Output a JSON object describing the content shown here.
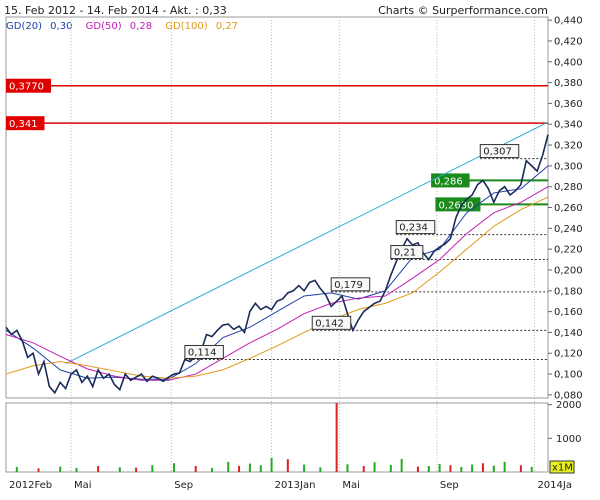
{
  "header": {
    "range_text": "15. Feb 2012 - 14. Feb 2014 - Akt. : 0,33",
    "credit_text": "Charts © Surperformance.com"
  },
  "legend": [
    {
      "label": "GD(20)",
      "value": "0,30",
      "color": "#1f3fa8"
    },
    {
      "label": "GD(50)",
      "value": "0,28",
      "color": "#c21fb8"
    },
    {
      "label": "GD(100)",
      "value": "0,27",
      "color": "#e09a1a"
    }
  ],
  "colors": {
    "price": "#1a2a5a",
    "trendline": "#29a9d9",
    "resistance": "#e00000",
    "support": "#1a8a1a",
    "level": "#333333",
    "volume_up": "#22aa22",
    "volume_down": "#dd2222",
    "label_bg": "#f8f8f8"
  },
  "chart_data": {
    "type": "line",
    "x_labels": [
      {
        "t": 0.0,
        "label": "2012Feb"
      },
      {
        "t": 0.12,
        "label": "Mai"
      },
      {
        "t": 0.305,
        "label": "Sep"
      },
      {
        "t": 0.49,
        "label": "2013Jan"
      },
      {
        "t": 0.615,
        "label": "Mai"
      },
      {
        "t": 0.795,
        "label": "Sep"
      },
      {
        "t": 0.975,
        "label": "2014Ja"
      }
    ],
    "y_ticks": [
      0.08,
      0.1,
      0.12,
      0.14,
      0.16,
      0.18,
      0.2,
      0.22,
      0.24,
      0.26,
      0.28,
      0.3,
      0.32,
      0.34,
      0.36,
      0.38,
      0.4,
      0.42,
      0.44
    ],
    "y_tick_labels": [
      "0,080",
      "0,100",
      "0,120",
      "0,140",
      "0,160",
      "0,180",
      "0,200",
      "0,220",
      "0,240",
      "0,260",
      "0,280",
      "0,300",
      "0,320",
      "0,340",
      "0,360",
      "0,380",
      "0,400",
      "0,420",
      "0,440"
    ],
    "ylim": [
      0.077,
      0.443
    ],
    "price": {
      "x": [
        0.0,
        0.01,
        0.02,
        0.03,
        0.04,
        0.05,
        0.06,
        0.07,
        0.08,
        0.09,
        0.1,
        0.11,
        0.12,
        0.13,
        0.14,
        0.15,
        0.16,
        0.17,
        0.18,
        0.19,
        0.2,
        0.21,
        0.22,
        0.23,
        0.24,
        0.25,
        0.26,
        0.27,
        0.28,
        0.29,
        0.3,
        0.31,
        0.32,
        0.33,
        0.34,
        0.35,
        0.36,
        0.37,
        0.38,
        0.39,
        0.4,
        0.41,
        0.42,
        0.43,
        0.44,
        0.45,
        0.46,
        0.47,
        0.48,
        0.49,
        0.5,
        0.51,
        0.52,
        0.53,
        0.54,
        0.55,
        0.56,
        0.57,
        0.58,
        0.59,
        0.6,
        0.61,
        0.62,
        0.63,
        0.64,
        0.65,
        0.66,
        0.67,
        0.68,
        0.69,
        0.7,
        0.71,
        0.72,
        0.73,
        0.74,
        0.75,
        0.76,
        0.77,
        0.78,
        0.79,
        0.8,
        0.81,
        0.82,
        0.83,
        0.84,
        0.85,
        0.86,
        0.87,
        0.88,
        0.89,
        0.9,
        0.91,
        0.92,
        0.93,
        0.94,
        0.95,
        0.96,
        0.97,
        0.98,
        0.99,
        1.0
      ],
      "y": [
        0.145,
        0.138,
        0.142,
        0.132,
        0.116,
        0.12,
        0.1,
        0.112,
        0.088,
        0.082,
        0.092,
        0.086,
        0.1,
        0.104,
        0.092,
        0.098,
        0.088,
        0.104,
        0.096,
        0.1,
        0.09,
        0.085,
        0.1,
        0.094,
        0.097,
        0.1,
        0.093,
        0.098,
        0.096,
        0.093,
        0.097,
        0.1,
        0.101,
        0.114,
        0.112,
        0.118,
        0.122,
        0.138,
        0.136,
        0.142,
        0.147,
        0.148,
        0.143,
        0.146,
        0.14,
        0.16,
        0.168,
        0.162,
        0.165,
        0.162,
        0.17,
        0.172,
        0.178,
        0.18,
        0.185,
        0.18,
        0.188,
        0.19,
        0.182,
        0.176,
        0.165,
        0.17,
        0.175,
        0.158,
        0.142,
        0.152,
        0.16,
        0.164,
        0.168,
        0.17,
        0.18,
        0.195,
        0.208,
        0.22,
        0.23,
        0.224,
        0.226,
        0.216,
        0.21,
        0.218,
        0.222,
        0.225,
        0.23,
        0.25,
        0.262,
        0.268,
        0.272,
        0.282,
        0.286,
        0.278,
        0.265,
        0.276,
        0.28,
        0.272,
        0.276,
        0.282,
        0.305,
        0.3,
        0.295,
        0.31,
        0.33
      ]
    },
    "series": [
      {
        "name": "GD(20)",
        "x": [
          0.0,
          0.05,
          0.1,
          0.15,
          0.2,
          0.25,
          0.3,
          0.35,
          0.4,
          0.45,
          0.5,
          0.55,
          0.6,
          0.65,
          0.7,
          0.75,
          0.8,
          0.85,
          0.9,
          0.95,
          1.0
        ],
        "y": [
          0.142,
          0.125,
          0.104,
          0.096,
          0.097,
          0.095,
          0.095,
          0.11,
          0.135,
          0.145,
          0.16,
          0.175,
          0.178,
          0.172,
          0.18,
          0.212,
          0.22,
          0.255,
          0.274,
          0.278,
          0.3
        ]
      },
      {
        "name": "GD(50)",
        "x": [
          0.0,
          0.05,
          0.1,
          0.15,
          0.2,
          0.25,
          0.3,
          0.35,
          0.4,
          0.45,
          0.5,
          0.55,
          0.6,
          0.65,
          0.7,
          0.75,
          0.8,
          0.85,
          0.9,
          0.95,
          1.0
        ],
        "y": [
          0.138,
          0.13,
          0.117,
          0.105,
          0.098,
          0.094,
          0.094,
          0.1,
          0.115,
          0.13,
          0.143,
          0.158,
          0.168,
          0.173,
          0.175,
          0.192,
          0.21,
          0.235,
          0.255,
          0.265,
          0.28
        ]
      },
      {
        "name": "GD(100)",
        "x": [
          0.0,
          0.05,
          0.1,
          0.15,
          0.2,
          0.25,
          0.3,
          0.35,
          0.4,
          0.45,
          0.5,
          0.55,
          0.6,
          0.65,
          0.7,
          0.75,
          0.8,
          0.85,
          0.9,
          0.95,
          1.0
        ],
        "y": [
          0.1,
          0.108,
          0.112,
          0.108,
          0.103,
          0.098,
          0.096,
          0.098,
          0.104,
          0.115,
          0.127,
          0.14,
          0.152,
          0.162,
          0.168,
          0.178,
          0.198,
          0.22,
          0.242,
          0.258,
          0.27
        ]
      }
    ],
    "trendline": {
      "x": [
        0.11,
        1.0
      ],
      "y": [
        0.11,
        0.342
      ]
    },
    "resistance_lines": [
      {
        "value": 0.377,
        "label": "0,3770"
      },
      {
        "value": 0.341,
        "label": "0,341"
      }
    ],
    "support_lines": [
      {
        "value": 0.286,
        "label": "0,286",
        "x_start": 0.8
      },
      {
        "value": 0.263,
        "label": "0,2630",
        "x_start": 0.82
      }
    ],
    "dashed_levels": [
      {
        "value": 0.307,
        "label": "0,307",
        "x_start": 0.875
      },
      {
        "value": 0.234,
        "label": "0,234",
        "x_start": 0.72
      },
      {
        "value": 0.21,
        "label": "0,21",
        "x_start": 0.71
      },
      {
        "value": 0.179,
        "label": "0,179",
        "x_start": 0.6
      },
      {
        "value": 0.142,
        "label": "0,142",
        "x_start": 0.565
      },
      {
        "value": 0.114,
        "label": "0,114",
        "x_start": 0.33
      }
    ],
    "volume": {
      "y_tick_labels": [
        "2000",
        "1000"
      ],
      "y_ticks": [
        2000,
        1000
      ],
      "ylim": [
        0,
        2050
      ],
      "unit_label": "x1M",
      "bars": [
        0.02,
        0.06,
        0.1,
        0.13,
        0.17,
        0.21,
        0.24,
        0.27,
        0.31,
        0.35,
        0.38,
        0.41,
        0.43,
        0.45,
        0.47,
        0.49,
        0.52,
        0.55,
        0.58,
        0.61,
        0.63,
        0.66,
        0.68,
        0.71,
        0.73,
        0.76,
        0.78,
        0.8,
        0.82,
        0.84,
        0.86,
        0.88,
        0.9,
        0.92,
        0.95,
        0.97
      ],
      "values": [
        150,
        110,
        160,
        120,
        180,
        140,
        130,
        200,
        260,
        180,
        120,
        300,
        180,
        250,
        200,
        420,
        380,
        220,
        140,
        2050,
        230,
        180,
        290,
        210,
        390,
        160,
        180,
        240,
        200,
        150,
        220,
        260,
        190,
        300,
        200,
        150
      ],
      "directions": [
        "up",
        "down",
        "up",
        "up",
        "down",
        "up",
        "down",
        "up",
        "up",
        "down",
        "up",
        "up",
        "down",
        "up",
        "up",
        "up",
        "down",
        "up",
        "up",
        "down",
        "up",
        "down",
        "up",
        "up",
        "up",
        "down",
        "up",
        "up",
        "down",
        "up",
        "up",
        "down",
        "up",
        "up",
        "down",
        "up"
      ]
    }
  }
}
